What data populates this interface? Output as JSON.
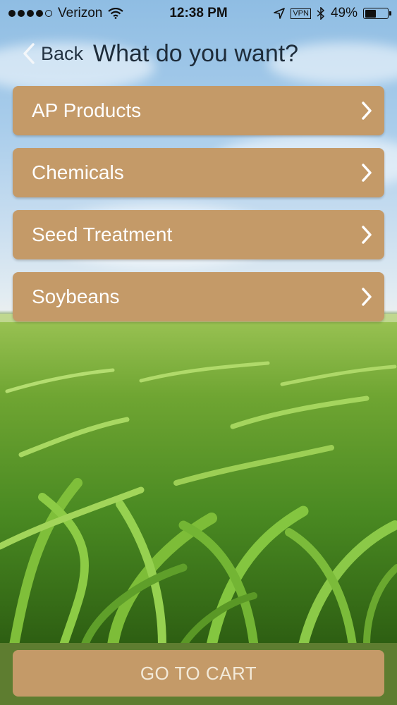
{
  "status_bar": {
    "carrier": "Verizon",
    "time": "12:38 PM",
    "vpn_label": "VPN",
    "battery_percent": "49%",
    "battery_level": 0.49,
    "signal_bars_filled": 4,
    "signal_bars_total": 5
  },
  "nav": {
    "back_label": "Back",
    "title": "What do you want?"
  },
  "menu": {
    "items": [
      {
        "label": "AP Products"
      },
      {
        "label": "Chemicals"
      },
      {
        "label": "Seed Treatment"
      },
      {
        "label": "Soybeans"
      }
    ]
  },
  "footer": {
    "cart_label": "GO TO CART"
  },
  "colors": {
    "button_tan": "#c49a68",
    "footer_green": "#5e7d30",
    "label_white": "#ffffff"
  }
}
